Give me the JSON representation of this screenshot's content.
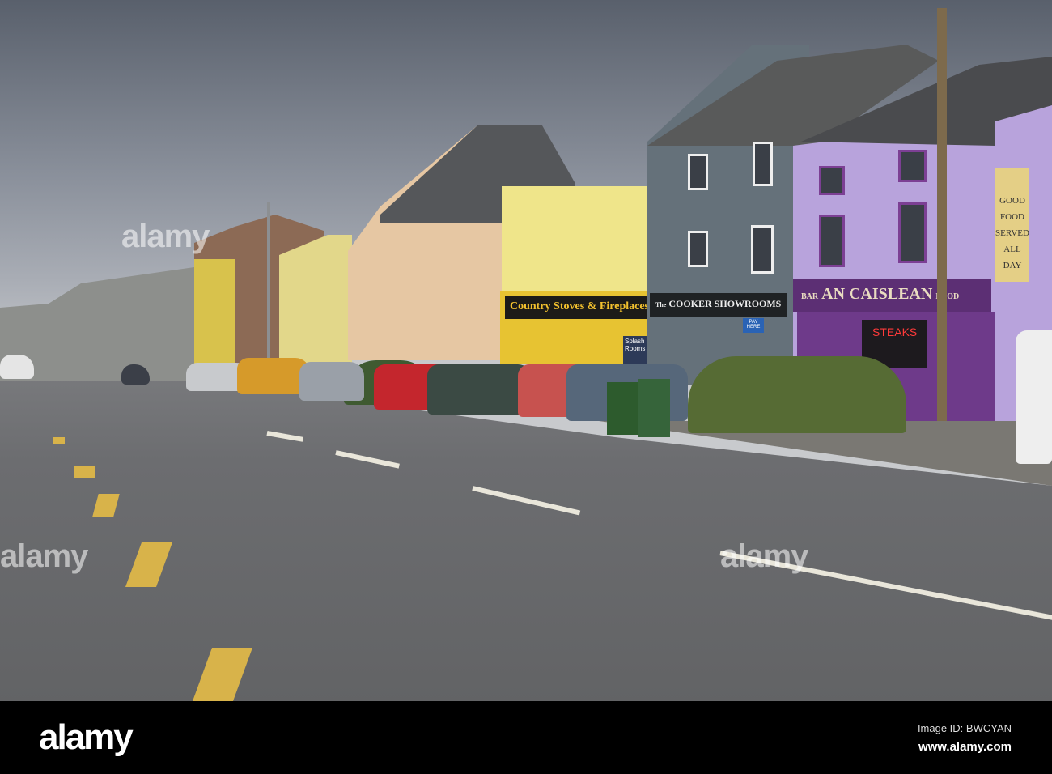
{
  "scene": {
    "signs": {
      "stoves": "Country Stoves & Fireplaces",
      "cooker": "COOKER SHOWROOMS",
      "cooker_prefix": "The",
      "bar_small": "BAR",
      "pub_name": "AN CAISLEAN",
      "food_small": "FOOD",
      "steaks": "STEAKS",
      "pay_here": "PAY HERE",
      "splash": "Splash Rooms",
      "board": [
        "GOOD",
        "FOOD",
        "SERVED",
        "ALL",
        "DAY"
      ]
    },
    "watermark": "alamy"
  },
  "footer": {
    "logo": "alamy",
    "image_id": "Image ID: BWCYAN",
    "url": "www.alamy.com"
  }
}
